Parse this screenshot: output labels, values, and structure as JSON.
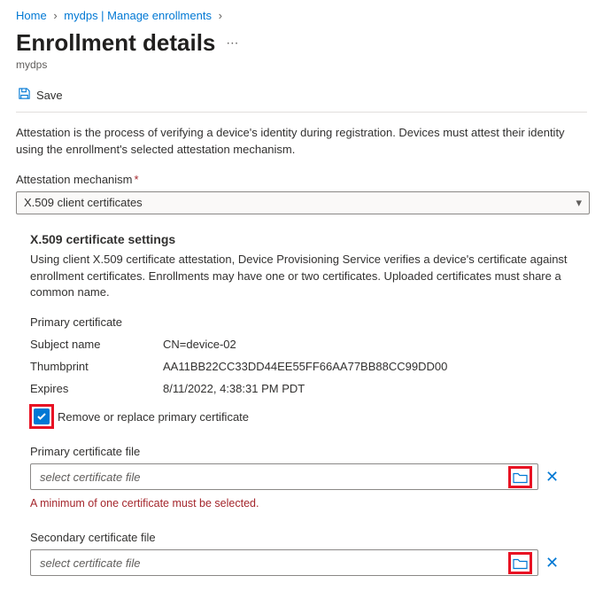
{
  "breadcrumb": {
    "home": "Home",
    "parent": "mydps | Manage enrollments"
  },
  "header": {
    "title": "Enrollment details",
    "subtitle": "mydps"
  },
  "toolbar": {
    "save_label": "Save"
  },
  "intro": {
    "text": "Attestation is the process of verifying a device's identity during registration. Devices must attest their identity using the enrollment's selected attestation mechanism."
  },
  "attestation": {
    "label": "Attestation mechanism",
    "value": "X.509 client certificates"
  },
  "x509": {
    "heading": "X.509 certificate settings",
    "description": "Using client X.509 certificate attestation, Device Provisioning Service verifies a device's certificate against enrollment certificates. Enrollments may have one or two certificates. Uploaded certificates must share a common name.",
    "primary": {
      "title": "Primary certificate",
      "subject_label": "Subject name",
      "subject_value": "CN=device-02",
      "thumbprint_label": "Thumbprint",
      "thumbprint_value": "AA11BB22CC33DD44EE55FF66AA77BB88CC99DD00",
      "expires_label": "Expires",
      "expires_value": "8/11/2022, 4:38:31 PM PDT",
      "remove_label": "Remove or replace primary certificate",
      "file_label": "Primary certificate file",
      "file_placeholder": "select certificate file",
      "error": "A minimum of one certificate must be selected."
    },
    "secondary": {
      "file_label": "Secondary certificate file",
      "file_placeholder": "select certificate file"
    }
  }
}
